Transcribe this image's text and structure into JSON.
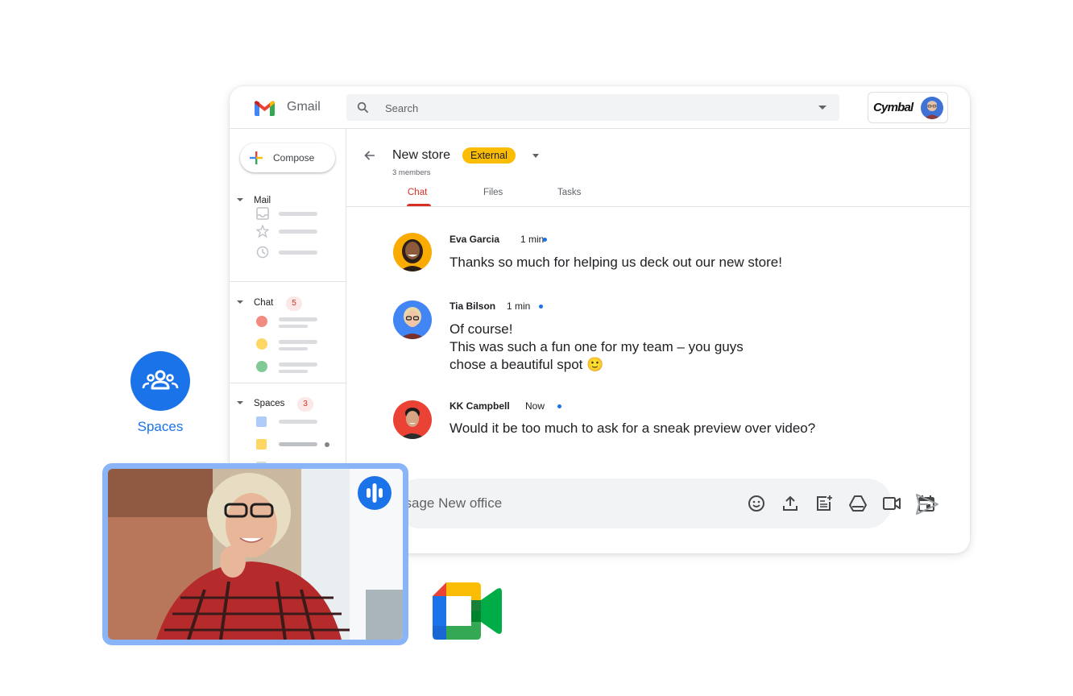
{
  "app": {
    "name": "Gmail",
    "search_placeholder": "Search",
    "brand_name": "Cymbal"
  },
  "sidebar": {
    "compose_label": "Compose",
    "sections": [
      {
        "label": "Mail"
      },
      {
        "label": "Chat",
        "badge": "5"
      },
      {
        "label": "Spaces",
        "badge": "3"
      }
    ]
  },
  "room": {
    "title": "New store",
    "badge": "External",
    "members": "3 members",
    "tabs": [
      {
        "label": "Chat",
        "active": true
      },
      {
        "label": "Files",
        "active": false
      },
      {
        "label": "Tasks",
        "active": false
      }
    ]
  },
  "messages": [
    {
      "name": "Eva Garcia",
      "time": "1 min",
      "online": true,
      "lines": [
        "Thanks so much for helping us deck out our new store!"
      ]
    },
    {
      "name": "Tia Bilson",
      "time": "1 min",
      "online": true,
      "lines": [
        "Of course!",
        "This was such a fun one for my team – you guys",
        "chose a beautiful spot 🙂"
      ]
    },
    {
      "name": "KK Campbell",
      "time": "Now",
      "online": true,
      "lines": [
        "Would it be too much to ask for a sneak preview over video?"
      ]
    }
  ],
  "composer": {
    "placeholder": "Message New office",
    "visible_placeholder": "ssage New office",
    "tools": [
      "emoji-icon",
      "upload-icon",
      "create-doc-icon",
      "drive-icon",
      "video-call-icon",
      "calendar-icon"
    ]
  },
  "floating": {
    "spaces_label": "Spaces",
    "video_speaking": true
  },
  "colors": {
    "accent_blue": "#1a73e8",
    "red": "#d93025",
    "yellow": "#fbbc04",
    "green": "#34a853",
    "badge_bg": "#fce8e6"
  }
}
